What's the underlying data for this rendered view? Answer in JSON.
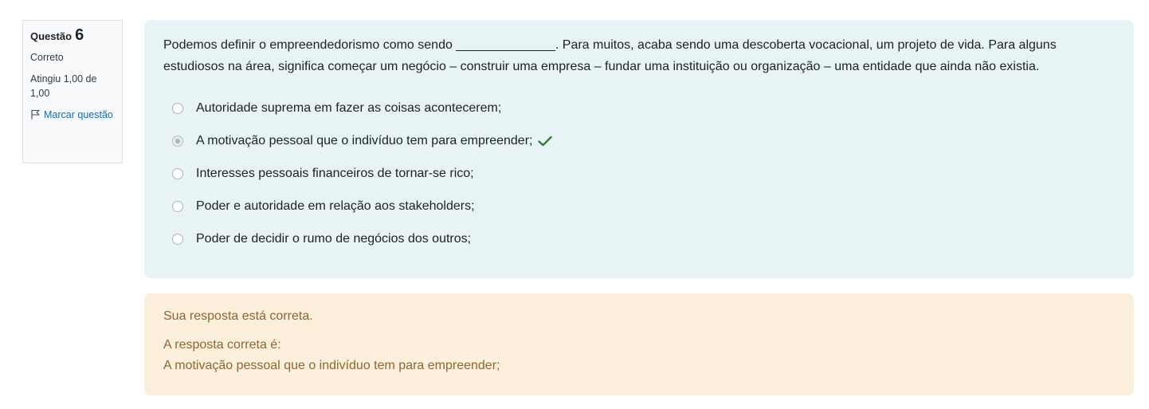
{
  "question_info": {
    "label": "Questão",
    "number": "6",
    "state": "Correto",
    "grade": "Atingiu 1,00 de 1,00",
    "flag_label": "Marcar questão"
  },
  "question": {
    "text": "Podemos definir o empreendedorismo como sendo ______________. Para muitos, acaba sendo uma descoberta vocacional, um projeto de vida. Para alguns estudiosos na área, significa começar um negócio – construir uma empresa – fundar uma instituição ou organização – uma entidade que ainda não existia.",
    "options": [
      {
        "label": "Autoridade suprema em fazer as coisas acontecerem;",
        "selected": false,
        "correct": false
      },
      {
        "label": "A motivação pessoal que o indivíduo tem para empreender;",
        "selected": true,
        "correct": true
      },
      {
        "label": "Interesses pessoais financeiros de tornar-se rico;",
        "selected": false,
        "correct": false
      },
      {
        "label": "Poder e autoridade em relação aos stakeholders;",
        "selected": false,
        "correct": false
      },
      {
        "label": "Poder de decidir o rumo de negócios dos outros;",
        "selected": false,
        "correct": false
      }
    ]
  },
  "feedback": {
    "general": "Sua resposta está correta.",
    "right_answer_label": "A resposta correta é:",
    "right_answer": "A motivação pessoal que o indivíduo tem para empreender;"
  },
  "colors": {
    "formulation_bg": "#e7f3f5",
    "outcome_bg": "#fcefdc",
    "outcome_text": "#8e662e",
    "link": "#0f6cbf",
    "correct_check": "#357a32"
  },
  "icons": {
    "flag": "flag-outline-icon",
    "correct": "checkmark-icon"
  }
}
